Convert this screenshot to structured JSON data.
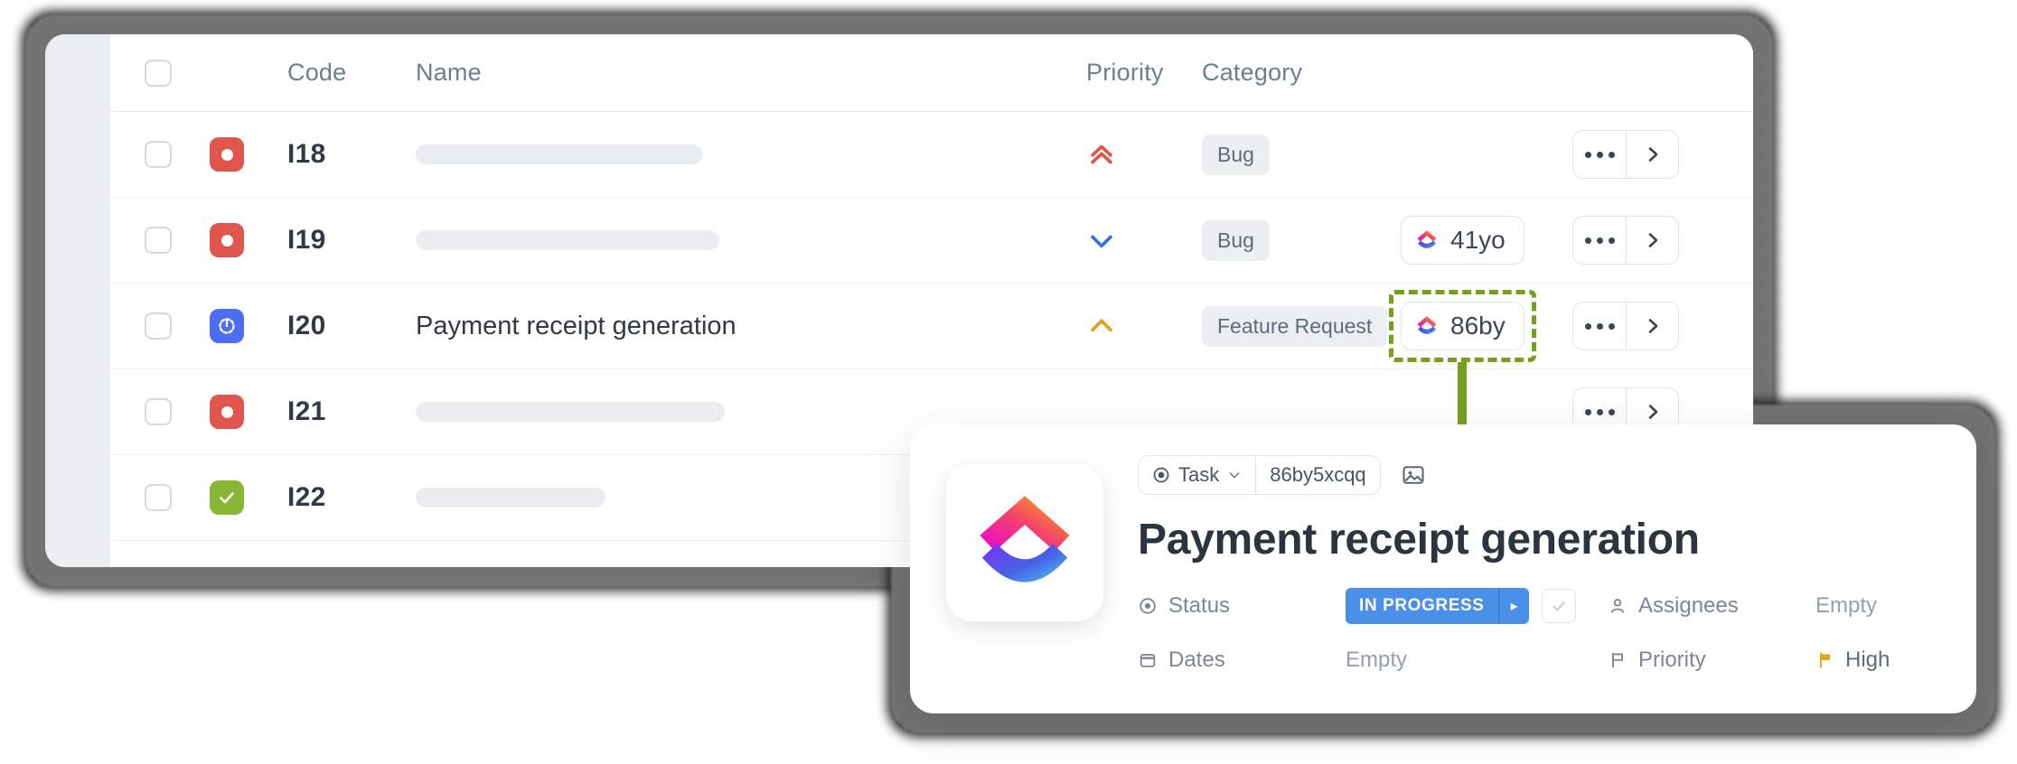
{
  "table": {
    "columns": [
      {
        "key": "check",
        "label": ""
      },
      {
        "key": "icon",
        "label": ""
      },
      {
        "key": "code",
        "label": "Code"
      },
      {
        "key": "name",
        "label": "Name"
      },
      {
        "key": "priority",
        "label": "Priority"
      },
      {
        "key": "category",
        "label": "Category"
      },
      {
        "key": "tag",
        "label": ""
      },
      {
        "key": "actions",
        "label": ""
      }
    ],
    "rows": [
      {
        "code": "I18",
        "name": "",
        "name_placeholder_width": 318,
        "type_icon": "bug-icon",
        "type_color": "#e0564e",
        "priority": "urgent",
        "priority_icon": "double-chevron-up-icon",
        "priority_color": "#e0564e",
        "category": "Bug",
        "tag": "",
        "tag_visible": false,
        "actions": {
          "more": "•••",
          "open": "›"
        }
      },
      {
        "code": "I19",
        "name": "",
        "name_placeholder_width": 336,
        "type_icon": "bug-icon",
        "type_color": "#e0564e",
        "priority": "low",
        "priority_icon": "chevron-down-icon",
        "priority_color": "#3b6fe0",
        "category": "Bug",
        "tag": "41yo",
        "tag_visible": true,
        "actions": {
          "more": "•••",
          "open": "›"
        }
      },
      {
        "code": "I20",
        "name": "Payment receipt generation",
        "name_placeholder_width": 0,
        "type_icon": "in-progress-icon",
        "type_color": "#4c6ef5",
        "priority": "high",
        "priority_icon": "chevron-up-icon",
        "priority_color": "#e89a22",
        "category": "Feature Request",
        "tag": "86by",
        "tag_visible": true,
        "highlighted": true,
        "actions": {
          "more": "•••",
          "open": "›"
        }
      },
      {
        "code": "I21",
        "name": "",
        "name_placeholder_width": 342,
        "type_icon": "bug-icon",
        "type_color": "#e0564e",
        "priority": "",
        "priority_icon": "",
        "priority_color": "",
        "category": "",
        "tag": "",
        "tag_visible": false,
        "actions": {
          "more": "•••",
          "open": "›"
        }
      },
      {
        "code": "I22",
        "name": "",
        "name_placeholder_width": 210,
        "type_icon": "complete-check-icon",
        "type_color": "#87b734",
        "priority": "",
        "priority_icon": "",
        "priority_color": "",
        "category": "",
        "tag": "",
        "tag_visible": false,
        "actions": {
          "more": "•••",
          "open": "›"
        }
      }
    ]
  },
  "highlight": {
    "color": "#74a01c",
    "style": "dashed"
  },
  "detail": {
    "type_label": "Task",
    "type_icon": "target-icon",
    "type_caret": "⌄",
    "task_id": "86by5xcqq",
    "cover_icon": "image-icon",
    "title": "Payment receipt generation",
    "fields": [
      {
        "icon": "target-icon",
        "label": "Status",
        "value": "IN PROGRESS",
        "kind": "status"
      },
      {
        "icon": "calendar-icon",
        "label": "Dates",
        "value": "Empty",
        "kind": "text"
      },
      {
        "icon": "person-icon",
        "label": "Assignees",
        "value": "Empty",
        "kind": "text"
      },
      {
        "icon": "flag-icon",
        "label": "Priority",
        "value": "High",
        "kind": "flag"
      }
    ],
    "status_color": "#4a90e8",
    "status_arrow": "▸",
    "priority_flag_color": "#e0a619",
    "logo_icon": "clickup-logo"
  }
}
